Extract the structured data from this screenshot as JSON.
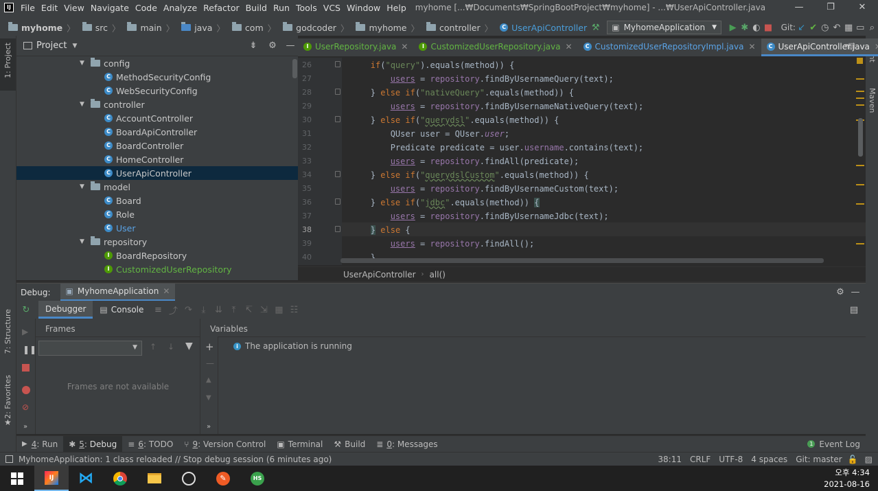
{
  "menubar": {
    "items": [
      "File",
      "Edit",
      "View",
      "Navigate",
      "Code",
      "Analyze",
      "Refactor",
      "Build",
      "Run",
      "Tools",
      "VCS",
      "Window",
      "Help"
    ],
    "title": "myhome [...₩Documents₩SpringBootProject₩myhome] - ...₩UserApiController.java"
  },
  "navbar": {
    "crumbs": [
      "myhome",
      "src",
      "main",
      "java",
      "com",
      "godcoder",
      "myhome",
      "controller",
      "UserApiController"
    ],
    "run_config": "MyhomeApplication",
    "git_label": "Git:"
  },
  "project": {
    "title": "Project",
    "tree": [
      {
        "label": "config",
        "kind": "folder",
        "indent": 1
      },
      {
        "label": "MethodSecurityConfig",
        "kind": "class",
        "indent": 2
      },
      {
        "label": "WebSecurityConfig",
        "kind": "class",
        "indent": 2
      },
      {
        "label": "controller",
        "kind": "folder",
        "indent": 1
      },
      {
        "label": "AccountController",
        "kind": "class",
        "indent": 2
      },
      {
        "label": "BoardApiController",
        "kind": "class",
        "indent": 2
      },
      {
        "label": "BoardController",
        "kind": "class",
        "indent": 2
      },
      {
        "label": "HomeController",
        "kind": "class",
        "indent": 2
      },
      {
        "label": "UserApiController",
        "kind": "class",
        "indent": 2,
        "selected": true
      },
      {
        "label": "model",
        "kind": "folder",
        "indent": 1
      },
      {
        "label": "Board",
        "kind": "class",
        "indent": 2
      },
      {
        "label": "Role",
        "kind": "class",
        "indent": 2
      },
      {
        "label": "User",
        "kind": "class",
        "indent": 2,
        "color": "blue"
      },
      {
        "label": "repository",
        "kind": "folder",
        "indent": 1
      },
      {
        "label": "BoardRepository",
        "kind": "interface",
        "indent": 2
      },
      {
        "label": "CustomizedUserRepository",
        "kind": "interface",
        "indent": 2,
        "color": "green"
      }
    ]
  },
  "tabs": [
    {
      "label": "UserRepository.java",
      "kind": "interface"
    },
    {
      "label": "CustomizedUserRepository.java",
      "kind": "interface"
    },
    {
      "label": "CustomizedUserRepositoryImpl.java",
      "kind": "class"
    },
    {
      "label": "UserApiController.java",
      "kind": "class",
      "active": true
    }
  ],
  "editor": {
    "line_numbers": [
      "26",
      "27",
      "28",
      "29",
      "30",
      "31",
      "32",
      "33",
      "34",
      "35",
      "36",
      "37",
      "38",
      "39",
      "40"
    ],
    "breadcrumb": [
      "UserApiController",
      "all()"
    ]
  },
  "debug": {
    "label": "Debug:",
    "session": "MyhomeApplication",
    "tabs": [
      "Debugger",
      "Console"
    ],
    "frames_header": "Frames",
    "frames_empty": "Frames are not available",
    "variables_header": "Variables",
    "running_message": "The application is running"
  },
  "bottom_tools": [
    {
      "num": "4",
      "label": "Run"
    },
    {
      "num": "5",
      "label": "Debug",
      "active": true
    },
    {
      "num": "6",
      "label": "TODO"
    },
    {
      "num": "9",
      "label": "Version Control"
    },
    {
      "num": "",
      "label": "Terminal"
    },
    {
      "num": "",
      "label": "Build"
    },
    {
      "num": "0",
      "label": "Messages"
    }
  ],
  "event_log": "Event Log",
  "status": {
    "message": "MyhomeApplication: 1 class reloaded // Stop debug session (6 minutes ago)",
    "position": "38:11",
    "line_sep": "CRLF",
    "encoding": "UTF-8",
    "indent": "4 spaces",
    "git": "Git: master"
  },
  "side_labels": {
    "project": "1: Project",
    "structure": "7: Structure",
    "favorites": "2: Favorites",
    "ant": "Ant",
    "maven": "Maven"
  },
  "taskbar": {
    "time": "오후 4:34",
    "date": "2021-08-16"
  },
  "colors": {
    "accent": "#4a88c7",
    "keyword": "#cc7832",
    "string": "#6a8759",
    "field": "#9876aa",
    "selected_row": "#0d293e"
  }
}
